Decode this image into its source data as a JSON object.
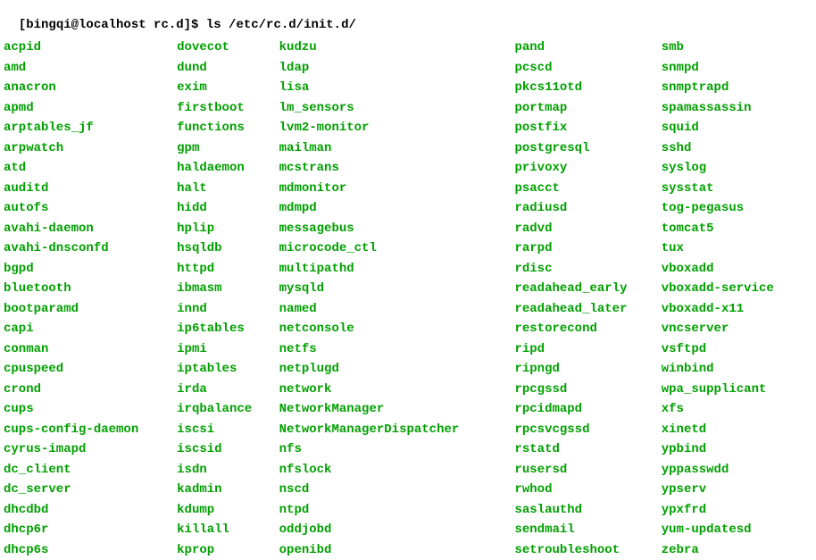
{
  "prompt": {
    "full": "[bingqi@localhost rc.d]$ ls /etc/rc.d/init.d/"
  },
  "columns": [
    [
      "acpid",
      "amd",
      "anacron",
      "apmd",
      "arptables_jf",
      "arpwatch",
      "atd",
      "auditd",
      "autofs",
      "avahi-daemon",
      "avahi-dnsconfd",
      "bgpd",
      "bluetooth",
      "bootparamd",
      "capi",
      "conman",
      "cpuspeed",
      "crond",
      "cups",
      "cups-config-daemon",
      "cyrus-imapd",
      "dc_client",
      "dc_server",
      "dhcdbd",
      "dhcp6r",
      "dhcp6s"
    ],
    [
      "dovecot",
      "dund",
      "exim",
      "firstboot",
      "functions",
      "gpm",
      "haldaemon",
      "halt",
      "hidd",
      "hplip",
      "hsqldb",
      "httpd",
      "ibmasm",
      "innd",
      "ip6tables",
      "ipmi",
      "iptables",
      "irda",
      "irqbalance",
      "iscsi",
      "iscsid",
      "isdn",
      "kadmin",
      "kdump",
      "killall",
      "kprop"
    ],
    [
      "kudzu",
      "ldap",
      "lisa",
      "lm_sensors",
      "lvm2-monitor",
      "mailman",
      "mcstrans",
      "mdmonitor",
      "mdmpd",
      "messagebus",
      "microcode_ctl",
      "multipathd",
      "mysqld",
      "named",
      "netconsole",
      "netfs",
      "netplugd",
      "network",
      "NetworkManager",
      "NetworkManagerDispatcher",
      "nfs",
      "nfslock",
      "nscd",
      "ntpd",
      "oddjobd",
      "openibd"
    ],
    [
      "pand",
      "pcscd",
      "pkcs11otd",
      "portmap",
      "postfix",
      "postgresql",
      "privoxy",
      "psacct",
      "radiusd",
      "radvd",
      "rarpd",
      "rdisc",
      "readahead_early",
      "readahead_later",
      "restorecond",
      "ripd",
      "ripngd",
      "rpcgssd",
      "rpcidmapd",
      "rpcsvcgssd",
      "rstatd",
      "rusersd",
      "rwhod",
      "saslauthd",
      "sendmail",
      "setroubleshoot"
    ],
    [
      "smb",
      "snmpd",
      "snmptrapd",
      "spamassassin",
      "squid",
      "sshd",
      "syslog",
      "sysstat",
      "tog-pegasus",
      "tomcat5",
      "tux",
      "vboxadd",
      "vboxadd-service",
      "vboxadd-x11",
      "vncserver",
      "vsftpd",
      "winbind",
      "wpa_supplicant",
      "xfs",
      "xinetd",
      "ypbind",
      "yppasswdd",
      "ypserv",
      "ypxfrd",
      "yum-updatesd",
      "zebra"
    ]
  ]
}
